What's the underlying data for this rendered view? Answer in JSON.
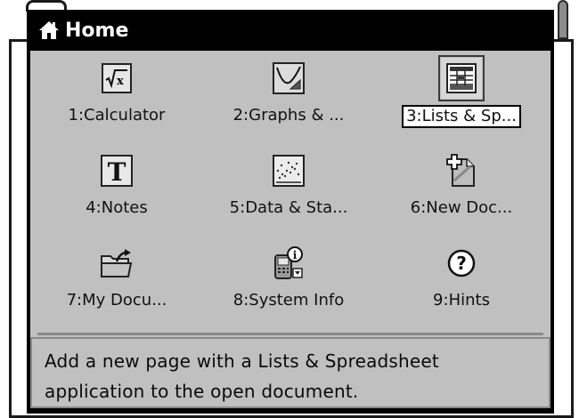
{
  "dialog": {
    "title": "Home",
    "icon": "home-icon"
  },
  "apps": [
    {
      "label": "1:Calculator",
      "icon": "calculator-icon",
      "selected": false
    },
    {
      "label": "2:Graphs & ...",
      "icon": "graphs-icon",
      "selected": false
    },
    {
      "label": "3:Lists & Sp...",
      "icon": "lists-spreadsheet-icon",
      "selected": true
    },
    {
      "label": "4:Notes",
      "icon": "notes-icon",
      "selected": false
    },
    {
      "label": "5:Data & Sta...",
      "icon": "data-statistics-icon",
      "selected": false
    },
    {
      "label": "6:New Doc...",
      "icon": "new-document-icon",
      "selected": false
    },
    {
      "label": "7:My Docu...",
      "icon": "my-documents-icon",
      "selected": false
    },
    {
      "label": "8:System Info",
      "icon": "system-info-icon",
      "selected": false
    },
    {
      "label": "9:Hints",
      "icon": "hints-icon",
      "selected": false
    }
  ],
  "description": "Add a new page with a Lists & Spreadsheet application to the open document.",
  "colors": {
    "title_bar": "#000000",
    "panel": "#c0c0c0",
    "selection_box": "#ffffff"
  }
}
